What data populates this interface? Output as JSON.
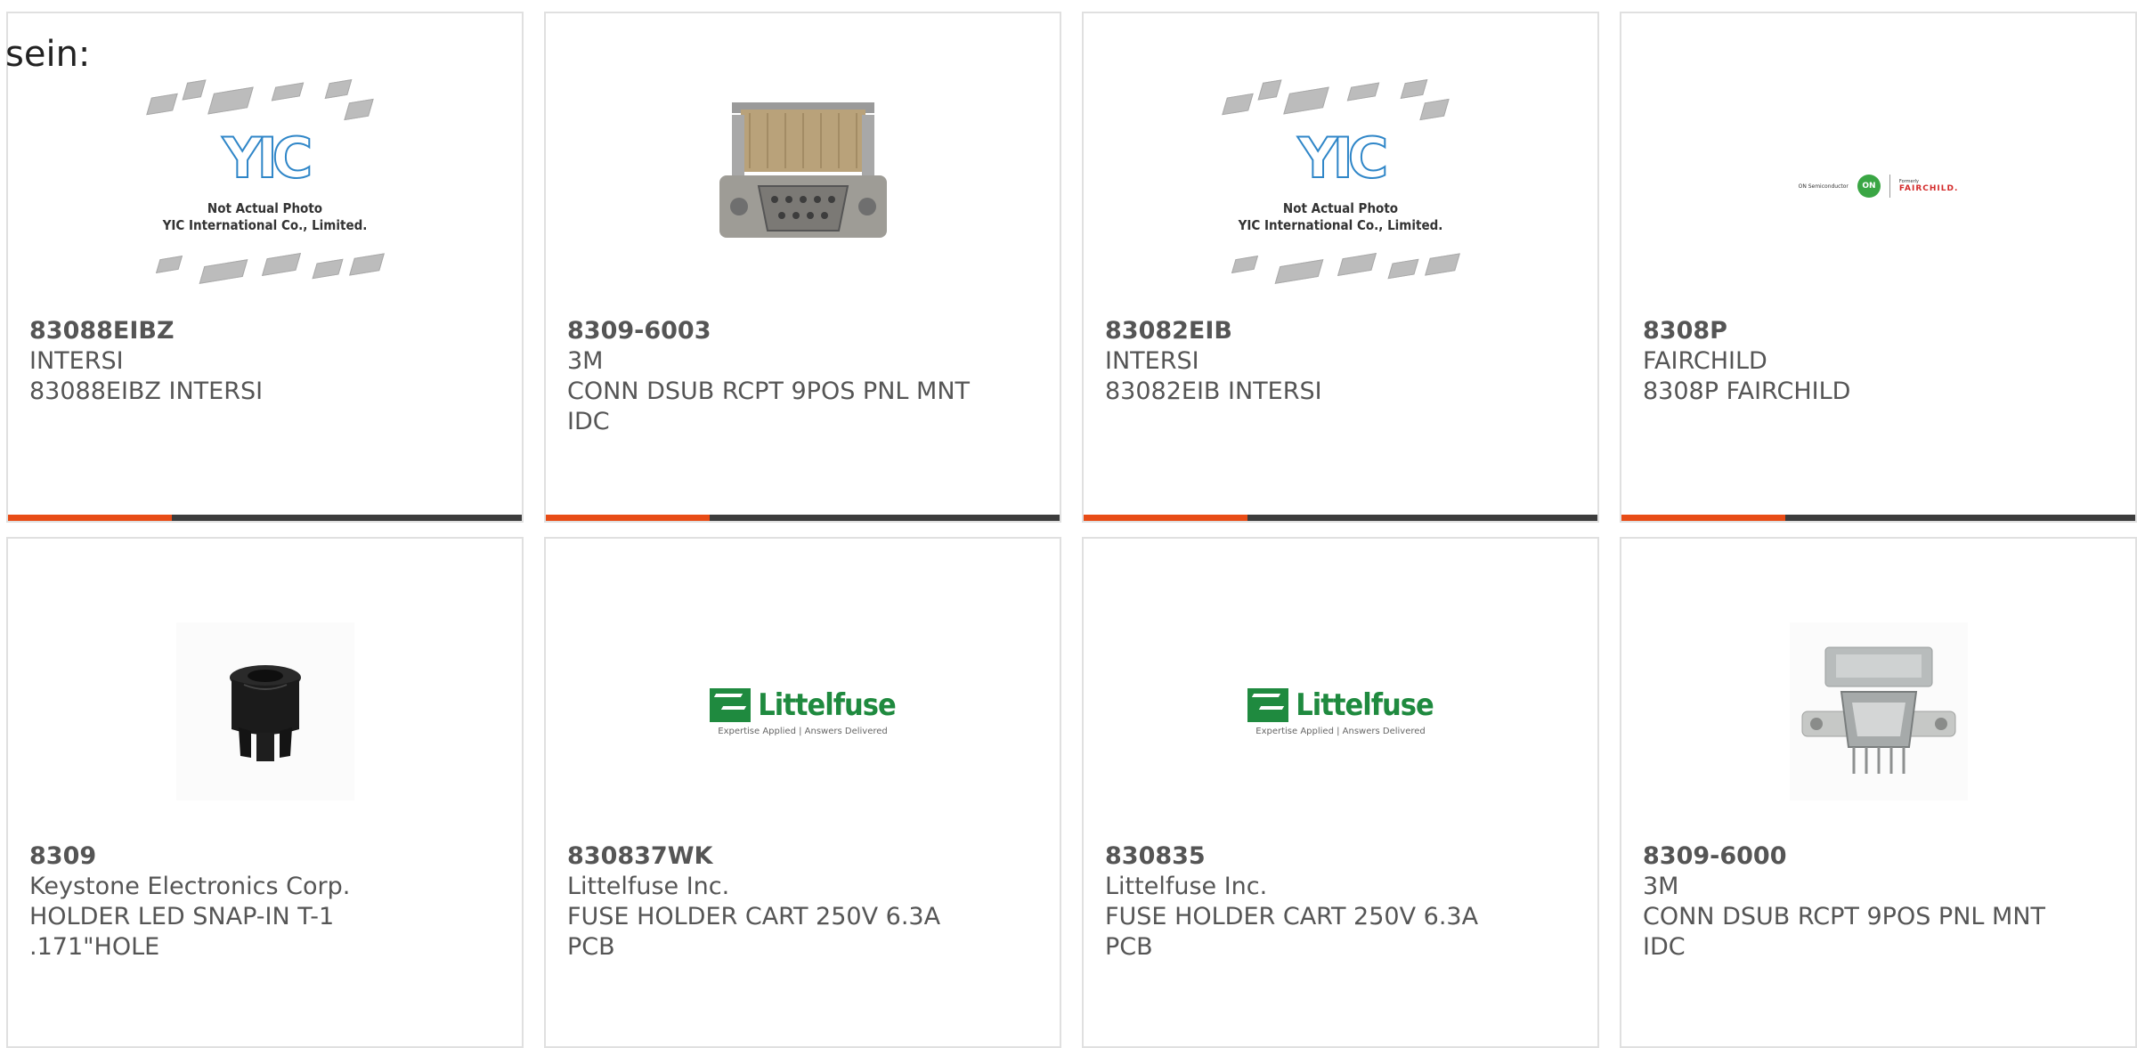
{
  "intro_text": "sein:",
  "colors": {
    "accent": "#e84c16",
    "bar": "#3c3c3c",
    "border": "#e0e0e0",
    "text": "#555555"
  },
  "products": [
    {
      "part": "83088EIBZ",
      "manufacturer": "INTERSI",
      "description": "83088EIBZ INTERSI",
      "image": "yic-placeholder",
      "placeholder_caption_1": "Not Actual Photo",
      "placeholder_caption_2": "YIC International Co., Limited.",
      "placeholder_logo": "YIC"
    },
    {
      "part": "8309-6003",
      "manufacturer": "3M",
      "description": "CONN DSUB RCPT 9POS PNL MNT IDC",
      "image": "dsub-connector-photo"
    },
    {
      "part": "83082EIB",
      "manufacturer": "INTERSI",
      "description": "83082EIB INTERSI",
      "image": "yic-placeholder",
      "placeholder_caption_1": "Not Actual Photo",
      "placeholder_caption_2": "YIC International Co., Limited.",
      "placeholder_logo": "YIC"
    },
    {
      "part": "8308P",
      "manufacturer": "FAIRCHILD",
      "description": "8308P FAIRCHILD",
      "image": "fairchild-logo",
      "logo_text_left": "ON Semiconductor",
      "logo_text_on": "ON",
      "logo_text_right_small": "Formerly",
      "logo_text_right": "FAIRCHILD."
    },
    {
      "part": "8309",
      "manufacturer": "Keystone Electronics Corp.",
      "description": "HOLDER LED SNAP-IN T-1 .171\"HOLE",
      "image": "led-holder-photo"
    },
    {
      "part": "830837WK",
      "manufacturer": "Littelfuse Inc.",
      "description": "FUSE HOLDER CART 250V 6.3A PCB",
      "image": "littelfuse-logo",
      "logo_text": "Littelfuse",
      "logo_tagline": "Expertise Applied | Answers Delivered"
    },
    {
      "part": "830835",
      "manufacturer": "Littelfuse Inc.",
      "description": "FUSE HOLDER CART 250V 6.3A PCB",
      "image": "littelfuse-logo",
      "logo_text": "Littelfuse",
      "logo_tagline": "Expertise Applied | Answers Delivered"
    },
    {
      "part": "8309-6000",
      "manufacturer": "3M",
      "description": "CONN DSUB RCPT 9POS PNL MNT IDC",
      "image": "dsub-connector-photo-alt"
    }
  ]
}
